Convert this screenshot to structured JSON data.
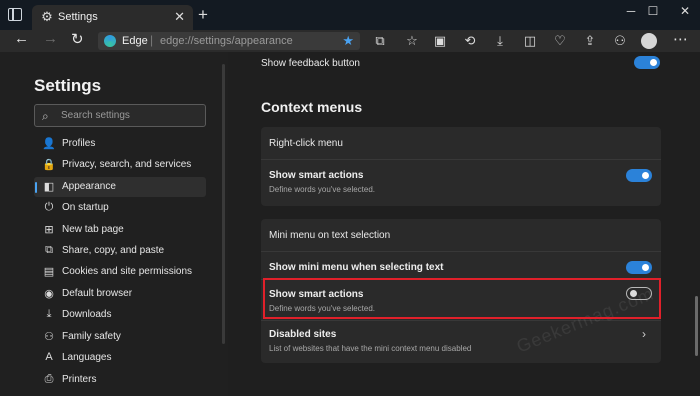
{
  "tab": {
    "title": "Settings"
  },
  "address": {
    "site": "Edge",
    "separator": "|",
    "url": "edge://settings/appearance"
  },
  "sidebar": {
    "title": "Settings",
    "search_placeholder": "Search settings",
    "items": [
      {
        "label": "Profiles",
        "icon": "person-icon"
      },
      {
        "label": "Privacy, search, and services",
        "icon": "lock-icon"
      },
      {
        "label": "Appearance",
        "icon": "appearance-icon",
        "active": true
      },
      {
        "label": "On startup",
        "icon": "power-icon"
      },
      {
        "label": "New tab page",
        "icon": "newtab-icon"
      },
      {
        "label": "Share, copy, and paste",
        "icon": "share-icon"
      },
      {
        "label": "Cookies and site permissions",
        "icon": "cookie-icon"
      },
      {
        "label": "Default browser",
        "icon": "browser-icon"
      },
      {
        "label": "Downloads",
        "icon": "download-icon"
      },
      {
        "label": "Family safety",
        "icon": "family-icon"
      },
      {
        "label": "Languages",
        "icon": "language-icon"
      },
      {
        "label": "Printers",
        "icon": "printer-icon"
      }
    ]
  },
  "main": {
    "feedback_label": "Show feedback button",
    "section_title": "Context menus",
    "right_click": {
      "header": "Right-click menu",
      "smart_title": "Show smart actions",
      "smart_desc": "Define words you've selected."
    },
    "mini_menu": {
      "header": "Mini menu on text selection",
      "show_title": "Show mini menu when selecting text",
      "smart_title": "Show smart actions",
      "smart_desc": "Define words you've selected.",
      "disabled_title": "Disabled sites",
      "disabled_desc": "List of websites that have the mini context menu disabled"
    },
    "watermark": "Geekermag.com"
  },
  "toggles": {
    "feedback": true,
    "right_click_smart": true,
    "mini_show": true,
    "mini_smart": false
  },
  "colors": {
    "accent": "#2b82d9",
    "highlight": "#e0202a"
  }
}
